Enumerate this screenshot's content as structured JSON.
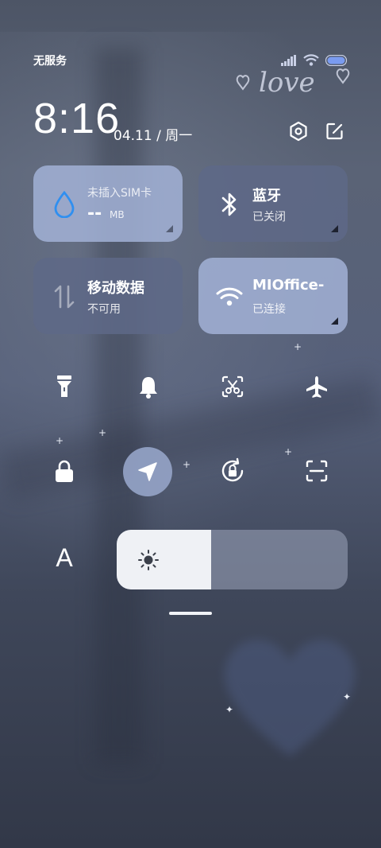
{
  "status_bar": {
    "carrier": "无服务",
    "icons": [
      "signal-icon",
      "wifi-icon",
      "battery-icon"
    ]
  },
  "wallpaper": {
    "love_text": "love"
  },
  "header": {
    "time": "8:16",
    "date": "04.11 / 周一",
    "settings_icon": "settings-icon",
    "edit_icon": "edit-icon"
  },
  "tiles": {
    "data_usage": {
      "title": "未插入SIM卡",
      "value": "--",
      "unit": "MB",
      "icon": "water-drop-icon"
    },
    "bluetooth": {
      "title": "蓝牙",
      "status": "已关闭",
      "icon": "bluetooth-icon"
    },
    "mobile_data": {
      "title": "移动数据",
      "status": "不可用",
      "icon": "data-arrows-icon"
    },
    "wifi": {
      "title": "MIOffice-",
      "status": "已连接",
      "icon": "wifi-icon"
    }
  },
  "toggles": [
    {
      "name": "flashlight",
      "icon": "flashlight-icon",
      "active": false
    },
    {
      "name": "bell",
      "icon": "bell-icon",
      "active": false
    },
    {
      "name": "screenshot",
      "icon": "screenshot-scissors-icon",
      "active": false
    },
    {
      "name": "airplane",
      "icon": "airplane-icon",
      "active": false
    },
    {
      "name": "lock",
      "icon": "lock-icon",
      "active": false
    },
    {
      "name": "location",
      "icon": "location-arrow-icon",
      "active": true
    },
    {
      "name": "rotation-lock",
      "icon": "rotation-lock-icon",
      "active": false
    },
    {
      "name": "scan",
      "icon": "scan-icon",
      "active": false
    }
  ],
  "brightness": {
    "font_label": "A",
    "level": 0.41,
    "icon": "sun-icon"
  },
  "colors": {
    "tile_light": "#a2b2d6",
    "tile_dark": "#5e6987",
    "accent_blue": "#2f8ff0",
    "active_toggle": "#91a0c3"
  }
}
